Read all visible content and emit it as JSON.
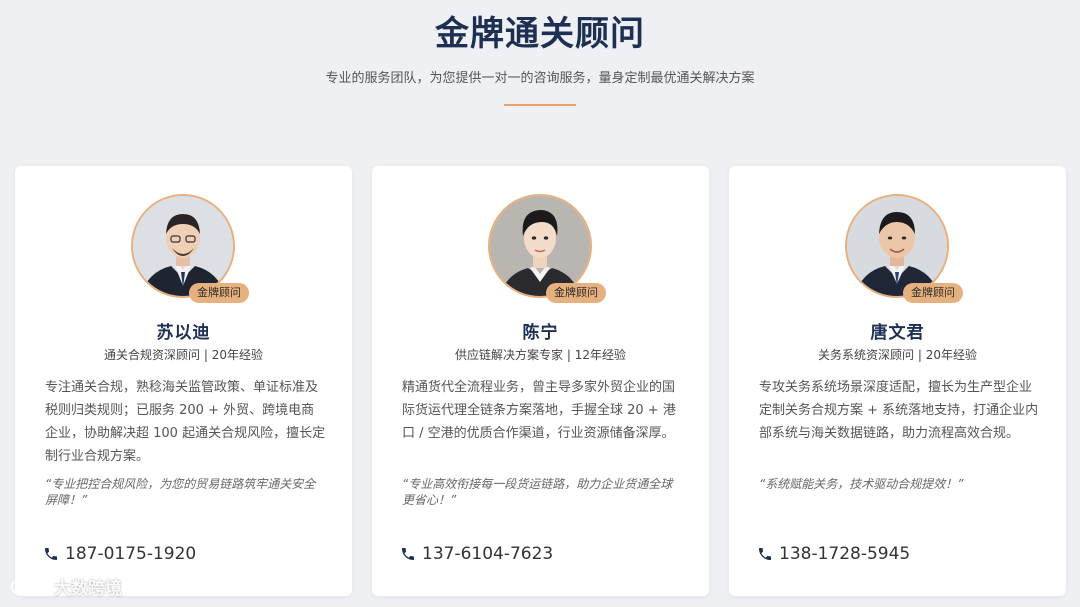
{
  "header": {
    "title": "金牌通关顾问",
    "subtitle": "专业的服务团队，为您提供一对一的咨询服务，量身定制最优通关解决方案",
    "accent_color": "#e6a26a"
  },
  "consultants": [
    {
      "badge": "金牌顾问",
      "name": "苏以迪",
      "role": "通关合规资深顾问 | 20年经验",
      "description": "专注通关合规，熟稔海关监管政策、单证标准及税则归类规则；已服务 200 + 外贸、跨境电商企业，协助解决超 100 起通关合规风险，擅长定制行业合规方案。",
      "quote": "“专业把控合规风险，为您的贸易链路筑牢通关安全屏障！”",
      "phone": "187-0175-1920",
      "phone_icon": "phone-icon"
    },
    {
      "badge": "金牌顾问",
      "name": "陈宁",
      "role": "供应链解决方案专家 | 12年经验",
      "description": "精通货代全流程业务，曾主导多家外贸企业的国际货运代理全链条方案落地，手握全球 20 + 港口 / 空港的优质合作渠道，行业资源储备深厚。",
      "quote": "“专业高效衔接每一段货运链路，助力企业货通全球更省心！”",
      "phone": "137-6104-7623",
      "phone_icon": "phone-icon"
    },
    {
      "badge": "金牌顾问",
      "name": "唐文君",
      "role": "关务系统资深顾问 | 20年经验",
      "description": "专攻关务系统场景深度适配，擅长为生产型企业定制关务合规方案 + 系统落地支持，打通企业内部系统与海关数据链路，助力流程高效合规。",
      "quote": "“系统赋能关务，技术驱动合规提效！”",
      "phone": "138-1728-5945",
      "phone_icon": "phone-icon"
    }
  ],
  "watermark": {
    "text": "大数跨境",
    "icon": "logo-icon"
  }
}
